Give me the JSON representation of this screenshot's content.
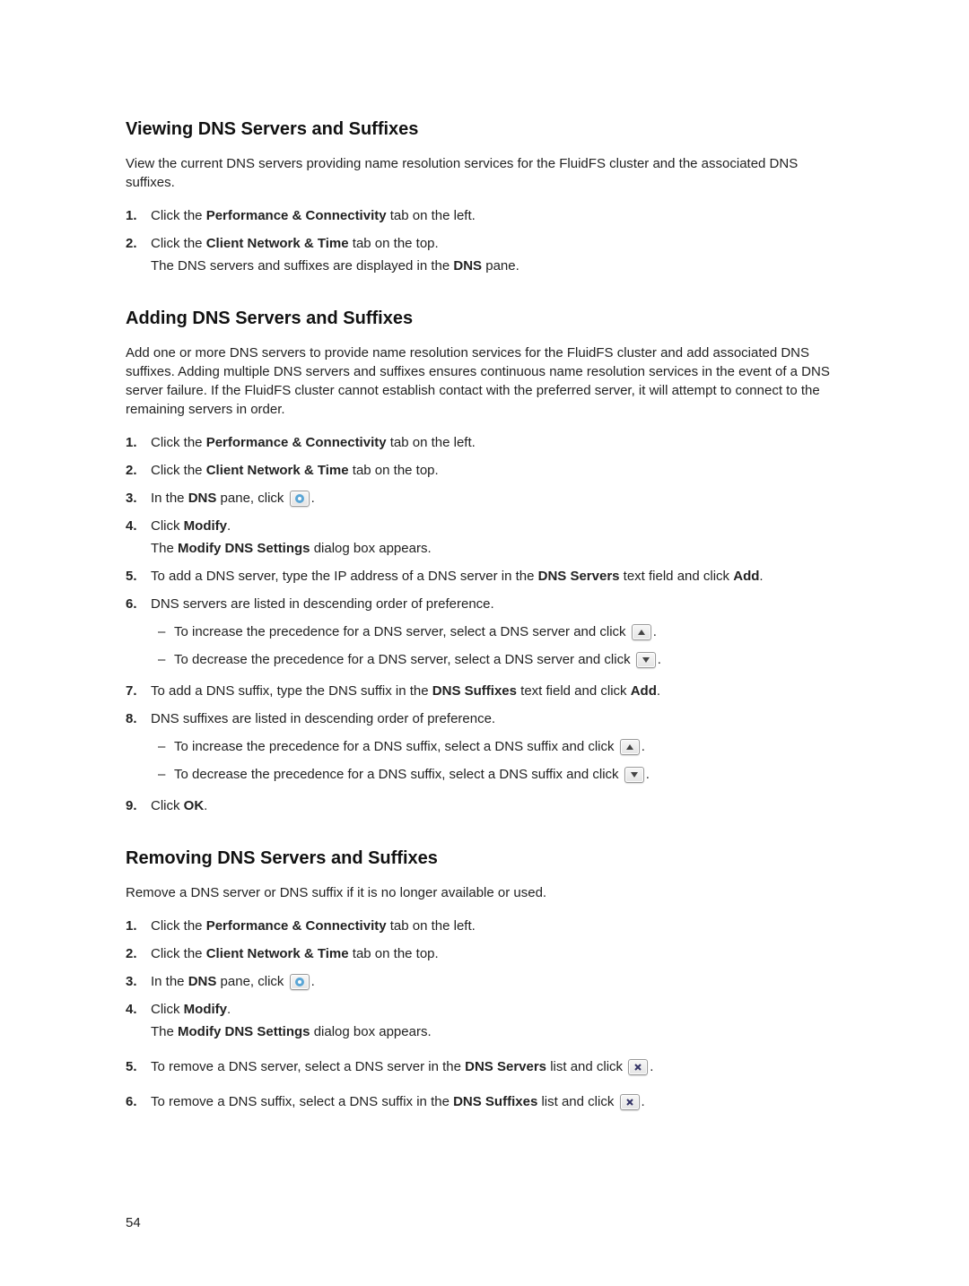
{
  "page_number": "54",
  "icons": {
    "gear": "gear-icon",
    "up": "arrow-up-icon",
    "down": "arrow-down-icon",
    "delete": "delete-x-icon"
  },
  "common": {
    "step_perf_tab": {
      "pre": "Click the ",
      "bold": "Performance & Connectivity",
      "post": " tab on the left."
    },
    "step_client_tab": {
      "pre": "Click the ",
      "bold": "Client Network & Time",
      "post": " tab on the top."
    },
    "step_dns_click": {
      "pre": "In the ",
      "bold": "DNS",
      "post": " pane, click "
    },
    "step_modify": {
      "pre": "Click ",
      "bold": "Modify",
      "post": "."
    },
    "modify_dialog": {
      "pre": "The ",
      "bold": "Modify DNS Settings",
      "post": " dialog box appears."
    }
  },
  "sections": {
    "viewing": {
      "heading": "Viewing DNS Servers and Suffixes",
      "intro": "View the current DNS servers providing name resolution services for the FluidFS cluster and the associated DNS suffixes.",
      "step2_extra": {
        "pre": "The DNS servers and suffixes are displayed in the ",
        "bold": "DNS",
        "post": " pane."
      }
    },
    "adding": {
      "heading": "Adding DNS Servers and Suffixes",
      "intro": "Add one or more DNS servers to provide name resolution services for the FluidFS cluster and add associated DNS suffixes. Adding multiple DNS servers and suffixes ensures continuous name resolution services in the event of a DNS server failure. If the FluidFS cluster cannot establish contact with the preferred server, it will attempt to connect to the remaining servers in order.",
      "step5": {
        "pre": "To add a DNS server, type the IP address of a DNS server in the ",
        "bold1": "DNS Servers",
        "mid": " text field and click ",
        "bold2": "Add",
        "post": "."
      },
      "step6": {
        "text": "DNS servers are listed in descending order of preference.",
        "sub_inc": "To increase the precedence for a DNS server, select a DNS server and click ",
        "sub_dec": "To decrease the precedence for a DNS server, select a DNS server and click "
      },
      "step7": {
        "pre": "To add a DNS suffix, type the DNS suffix in the ",
        "bold1": "DNS Suffixes",
        "mid": " text field and click ",
        "bold2": "Add",
        "post": "."
      },
      "step8": {
        "text": "DNS suffixes are listed in descending order of preference.",
        "sub_inc": "To increase the precedence for a DNS suffix, select a DNS suffix and click ",
        "sub_dec": "To decrease the precedence for a DNS suffix, select a DNS suffix and click "
      },
      "step9": {
        "pre": "Click ",
        "bold": "OK",
        "post": "."
      }
    },
    "removing": {
      "heading": "Removing DNS Servers and Suffixes",
      "intro": "Remove a DNS server or DNS suffix if it is no longer available or used.",
      "step5": {
        "pre": "To remove a DNS server, select a DNS server in the ",
        "bold": "DNS Servers",
        "post": " list and click "
      },
      "step6": {
        "pre": "To remove a DNS suffix, select a DNS suffix in the ",
        "bold": "DNS Suffixes",
        "post": " list and click "
      }
    }
  }
}
